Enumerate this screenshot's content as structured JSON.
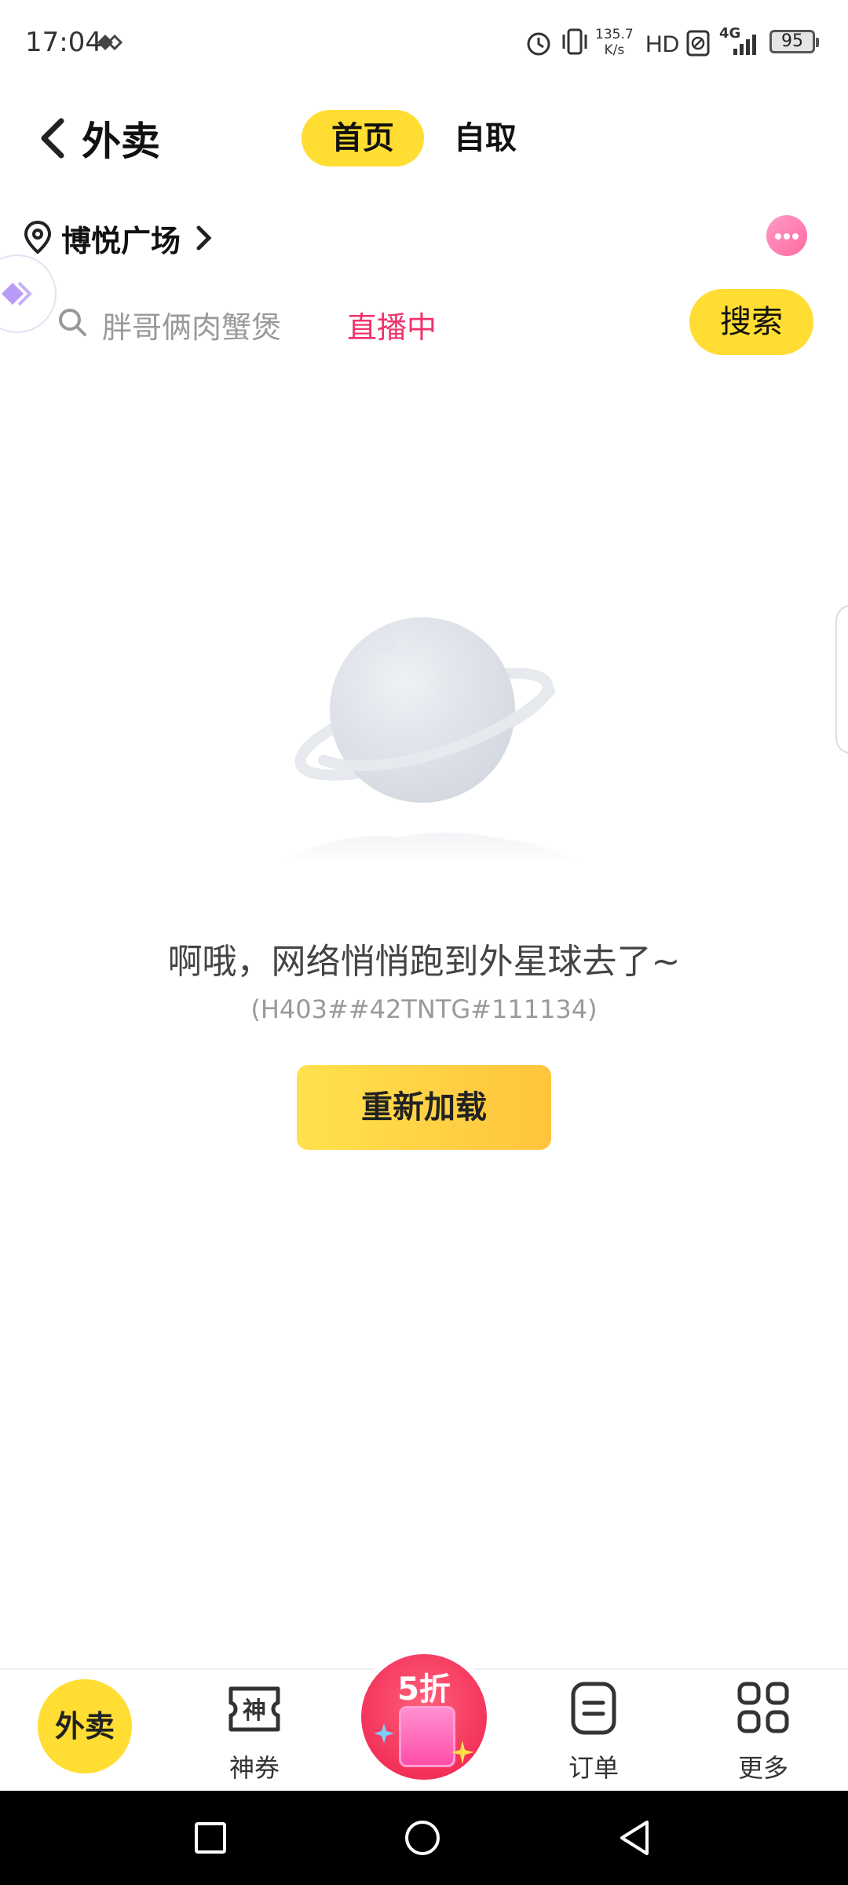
{
  "status_bar": {
    "time": "17:04",
    "net_speed_value": "135.7",
    "net_speed_unit": "K/s",
    "network": "4G",
    "battery": "95"
  },
  "header": {
    "back_icon": "chevron-left-icon",
    "title": "外卖",
    "tabs": [
      {
        "label": "首页",
        "active": true
      },
      {
        "label": "自取",
        "active": false
      }
    ]
  },
  "location": {
    "label": "博悦广场"
  },
  "search": {
    "placeholder": "胖哥俩肉蟹煲",
    "live_badge": "直播中",
    "button_label": "搜索"
  },
  "error": {
    "message": "啊哦，网络悄悄跑到外星球去了~",
    "code": "(H403##42TNTG#111134)",
    "reload_label": "重新加载"
  },
  "bottom_nav": {
    "items": [
      {
        "label": "外卖",
        "icon": "takeout-icon"
      },
      {
        "label": "神券",
        "icon": "coupon-icon"
      },
      {
        "label": "5折",
        "icon": "promo-gift-icon"
      },
      {
        "label": "订单",
        "icon": "order-icon"
      },
      {
        "label": "更多",
        "icon": "grid-icon"
      }
    ]
  },
  "colors": {
    "accent_yellow": "#ffdd33",
    "live_pink": "#f0336c",
    "promo_red": "#ee1f4c"
  }
}
